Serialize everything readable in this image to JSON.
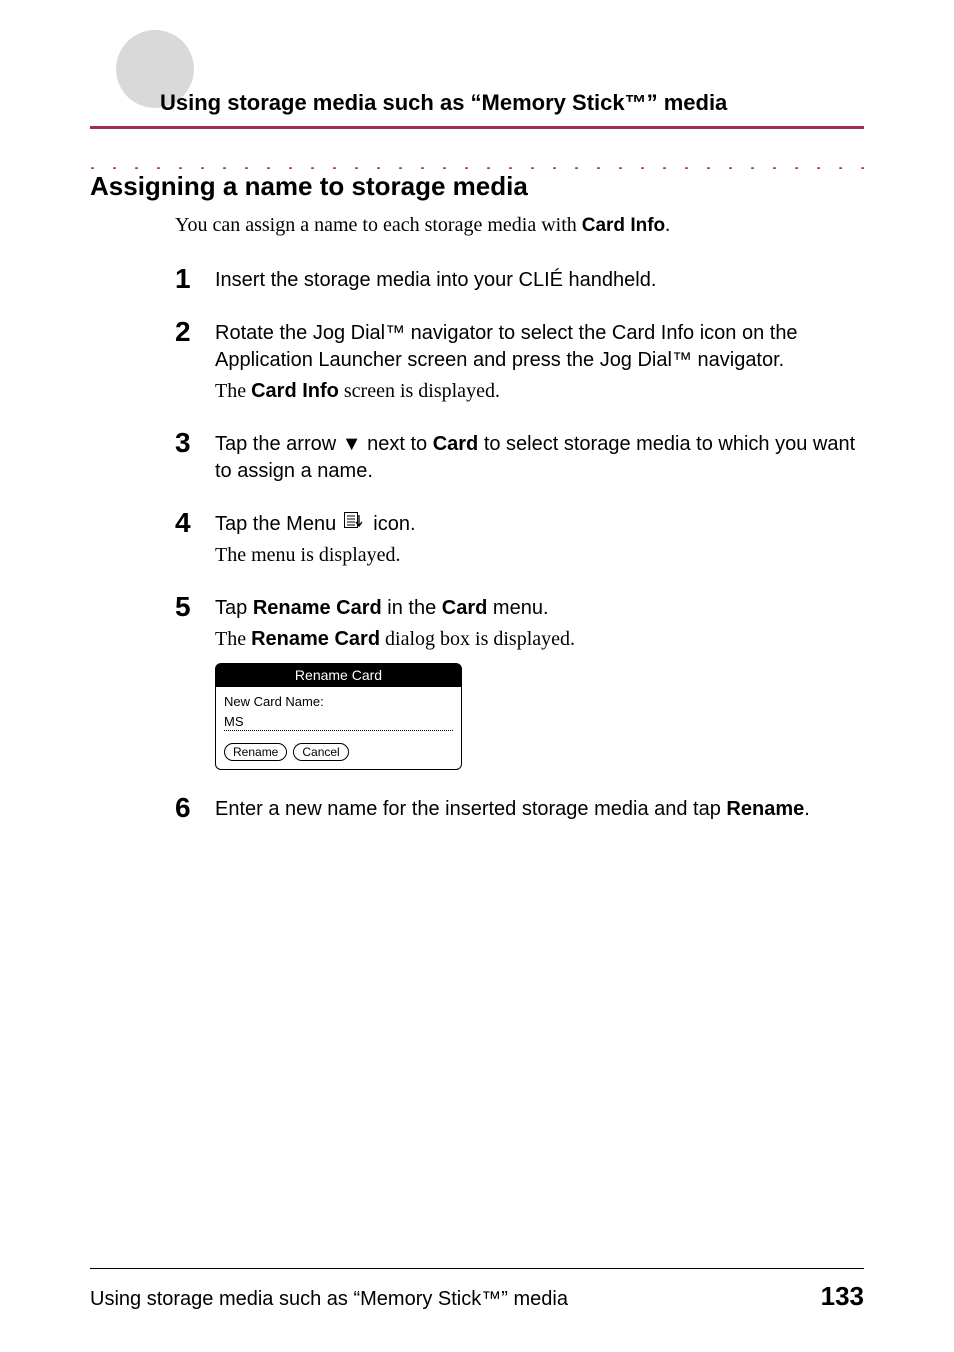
{
  "header": {
    "breadcrumb": "Using storage media such as “Memory Stick™” media"
  },
  "title": "Assigning a name to storage media",
  "intro": {
    "pre": "You can assign a name to each storage media with ",
    "bold": "Card Info",
    "post": "."
  },
  "steps": {
    "s1": {
      "num": "1",
      "text": "Insert the storage media into your CLIÉ handheld."
    },
    "s2": {
      "num": "2",
      "text": "Rotate the Jog Dial™ navigator to select the Card Info icon on the Application Launcher screen and press the Jog Dial™ navigator.",
      "sub_pre": "The ",
      "sub_bold": "Card Info",
      "sub_post": " screen is displayed."
    },
    "s3": {
      "num": "3",
      "pre": "Tap the arrow ▼ next to ",
      "bold": "Card",
      "post": " to select storage media to which you want to assign a name."
    },
    "s4": {
      "num": "4",
      "pre": "Tap the Menu ",
      "post": " icon.",
      "sub": "The menu is displayed."
    },
    "s5": {
      "num": "5",
      "pre": "Tap ",
      "b1": "Rename Card",
      "mid": " in the ",
      "b2": "Card",
      "post": " menu.",
      "sub_pre": "The ",
      "sub_bold": "Rename Card",
      "sub_post": " dialog box is displayed."
    },
    "s6": {
      "num": "6",
      "pre": "Enter a new name for the inserted storage media and tap ",
      "bold": "Rename",
      "post": "."
    }
  },
  "dialog": {
    "title": "Rename Card",
    "label": "New Card Name:",
    "value": "MS",
    "rename": "Rename",
    "cancel": "Cancel"
  },
  "footer": {
    "text": "Using storage media such as “Memory Stick™” media",
    "page": "133"
  }
}
